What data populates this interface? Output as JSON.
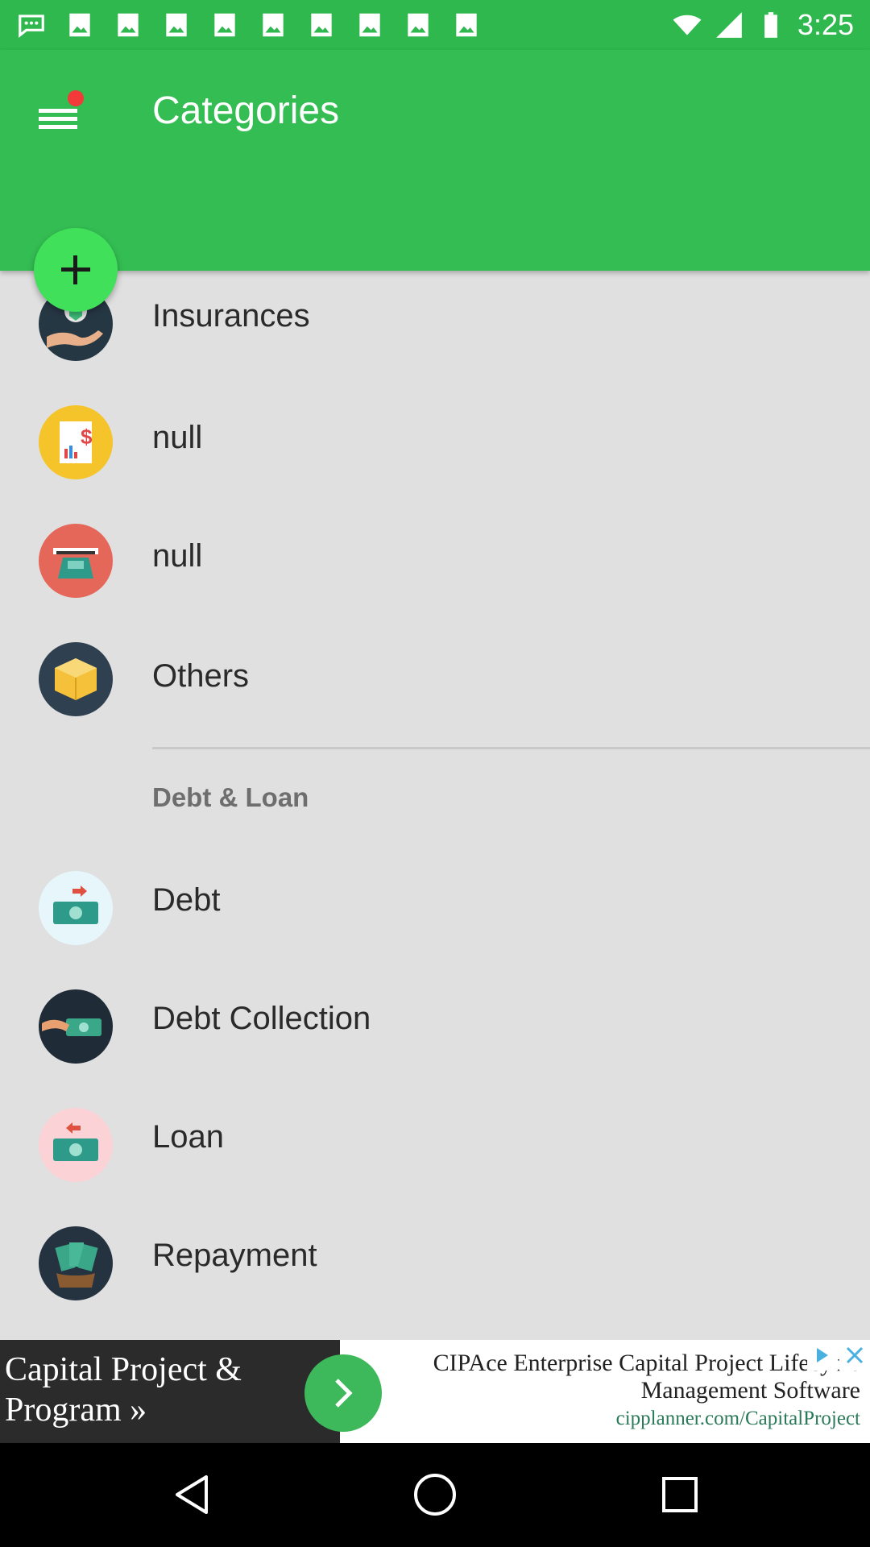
{
  "status_bar": {
    "time": "3:25",
    "icons": [
      "chat-icon",
      "photo-icon",
      "photo-icon",
      "photo-icon",
      "photo-icon",
      "photo-icon",
      "photo-icon",
      "photo-icon",
      "photo-icon",
      "photo-icon",
      "wifi-icon",
      "signal-icon",
      "battery-icon"
    ]
  },
  "app_bar": {
    "title": "Categories",
    "menu_icon": "menu-icon",
    "accent_color": "#33bd52"
  },
  "fab": {
    "icon": "plus-icon"
  },
  "list": {
    "items": [
      {
        "label": "Insurances",
        "icon": "insurance-hand-icon"
      },
      {
        "label": "null",
        "icon": "dollar-document-icon"
      },
      {
        "label": "null",
        "icon": "atm-cash-icon"
      },
      {
        "label": "Others",
        "icon": "box-icon"
      }
    ],
    "section": {
      "title": "Debt & Loan"
    },
    "section_items": [
      {
        "label": "Debt",
        "icon": "debt-money-icon"
      },
      {
        "label": "Debt Collection",
        "icon": "hand-money-icon"
      },
      {
        "label": "Loan",
        "icon": "loan-money-icon"
      },
      {
        "label": "Repayment",
        "icon": "repayment-money-icon"
      }
    ]
  },
  "ad": {
    "left_text": "Capital Project & Program »",
    "headline": "CIPAce Enterprise Capital Project Lifecycle Management Software",
    "url": "cipplanner.com/CapitalProject"
  },
  "nav": {
    "buttons": [
      "back-icon",
      "home-icon",
      "recents-icon"
    ]
  }
}
